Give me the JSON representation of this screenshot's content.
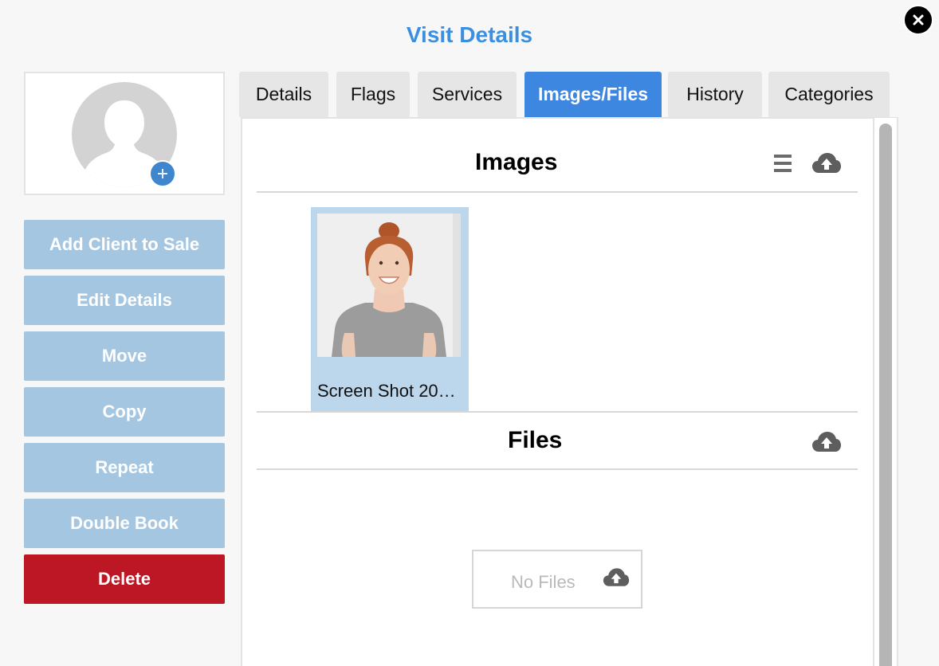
{
  "dialog": {
    "title": "Visit Details",
    "close_icon": "close-icon"
  },
  "client": {
    "avatar_icon": "person-placeholder-icon",
    "add_photo_icon": "plus-icon"
  },
  "actions": {
    "add_client_to_sale": "Add Client to Sale",
    "edit_details": "Edit Details",
    "move": "Move",
    "copy": "Copy",
    "repeat": "Repeat",
    "double_book": "Double Book",
    "delete": "Delete"
  },
  "tabs": [
    {
      "label": "Details",
      "active": false
    },
    {
      "label": "Flags",
      "active": false
    },
    {
      "label": "Services",
      "active": false
    },
    {
      "label": "Images/Files",
      "active": true
    },
    {
      "label": "History",
      "active": false
    },
    {
      "label": "Categories",
      "active": false
    }
  ],
  "images_section": {
    "title": "Images",
    "list_view_icon": "list-icon",
    "upload_icon": "cloud-upload-icon",
    "items": [
      {
        "caption": "Screen Shot 20…",
        "thumbnail": "photo-of-smiling-woman"
      }
    ]
  },
  "files_section": {
    "title": "Files",
    "upload_icon": "cloud-upload-icon",
    "empty_label": "No Files"
  },
  "colors": {
    "accent": "#3e87e0",
    "title": "#3c8fdf",
    "action_button": "#a5c6e1",
    "danger": "#bd1624",
    "selected_card": "#bcd6ec"
  }
}
